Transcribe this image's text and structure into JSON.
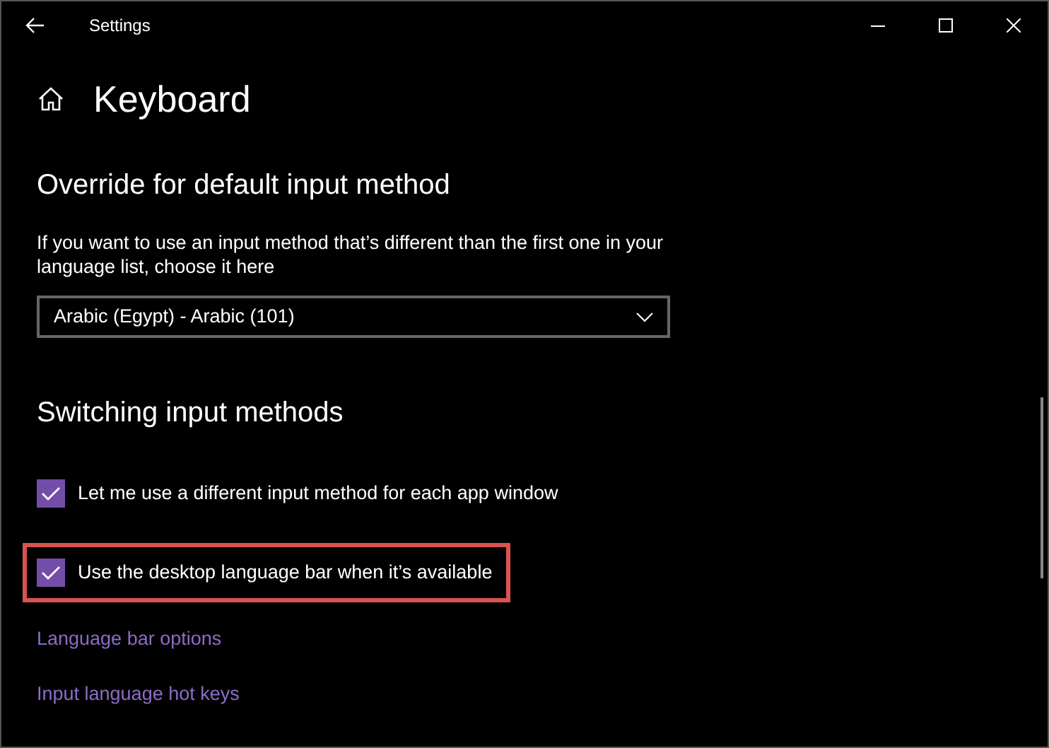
{
  "window": {
    "title": "Settings"
  },
  "page": {
    "title": "Keyboard"
  },
  "override": {
    "heading": "Override for default input method",
    "description": "If you want to use an input method that’s different than the first one in your language list, choose it here",
    "dropdown": {
      "value": "Arabic (Egypt) - Arabic (101)"
    }
  },
  "switching": {
    "heading": "Switching input methods",
    "options": [
      {
        "label": "Let me use a different input method for each app window",
        "checked": true,
        "highlighted": false
      },
      {
        "label": "Use the desktop language bar when it’s available",
        "checked": true,
        "highlighted": true
      }
    ]
  },
  "links": [
    "Language bar options",
    "Input language hot keys"
  ]
}
